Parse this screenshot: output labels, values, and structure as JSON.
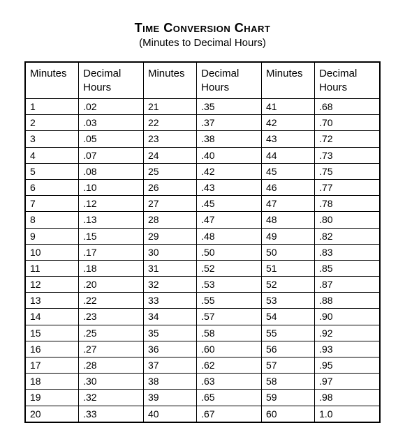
{
  "title": "Time Conversion Chart",
  "subtitle": "(Minutes to Decimal Hours)",
  "headers": {
    "minutes": "Minutes",
    "decimal": "Decimal Hours"
  },
  "chart_data": {
    "type": "table",
    "title": "Time Conversion Chart (Minutes to Decimal Hours)",
    "columns": [
      "Minutes",
      "Decimal Hours",
      "Minutes",
      "Decimal Hours",
      "Minutes",
      "Decimal Hours"
    ],
    "rows": [
      [
        "1",
        ".02",
        "21",
        ".35",
        "41",
        ".68"
      ],
      [
        "2",
        ".03",
        "22",
        ".37",
        "42",
        ".70"
      ],
      [
        "3",
        ".05",
        "23",
        ".38",
        "43",
        ".72"
      ],
      [
        "4",
        ".07",
        "24",
        ".40",
        "44",
        ".73"
      ],
      [
        "5",
        ".08",
        "25",
        ".42",
        "45",
        ".75"
      ],
      [
        "6",
        ".10",
        "26",
        ".43",
        "46",
        ".77"
      ],
      [
        "7",
        ".12",
        "27",
        ".45",
        "47",
        ".78"
      ],
      [
        "8",
        ".13",
        "28",
        ".47",
        "48",
        ".80"
      ],
      [
        "9",
        ".15",
        "29",
        ".48",
        "49",
        ".82"
      ],
      [
        "10",
        ".17",
        "30",
        ".50",
        "50",
        ".83"
      ],
      [
        "11",
        ".18",
        "31",
        ".52",
        "51",
        ".85"
      ],
      [
        "12",
        ".20",
        "32",
        ".53",
        "52",
        ".87"
      ],
      [
        "13",
        ".22",
        "33",
        ".55",
        "53",
        ".88"
      ],
      [
        "14",
        ".23",
        "34",
        ".57",
        "54",
        ".90"
      ],
      [
        "15",
        ".25",
        "35",
        ".58",
        "55",
        ".92"
      ],
      [
        "16",
        ".27",
        "36",
        ".60",
        "56",
        ".93"
      ],
      [
        "17",
        ".28",
        "37",
        ".62",
        "57",
        ".95"
      ],
      [
        "18",
        ".30",
        "38",
        ".63",
        "58",
        ".97"
      ],
      [
        "19",
        ".32",
        "39",
        ".65",
        "59",
        ".98"
      ],
      [
        "20",
        ".33",
        "40",
        ".67",
        "60",
        "1.0"
      ]
    ]
  }
}
